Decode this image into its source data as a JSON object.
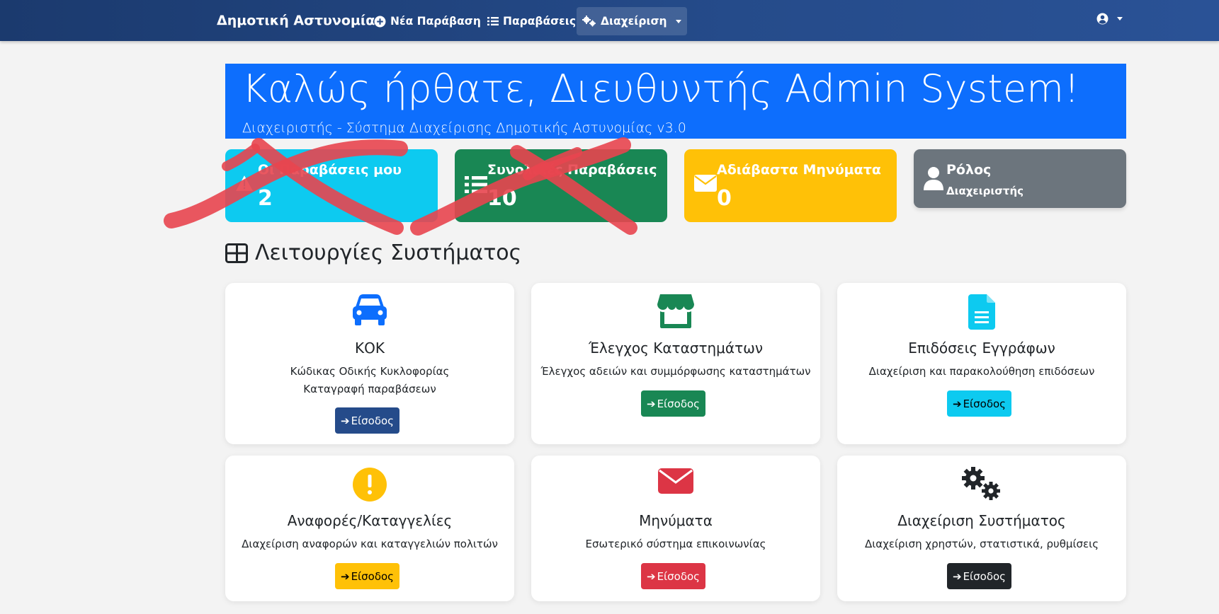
{
  "navbar": {
    "brand": "Δημοτική Αστυνομία",
    "items": [
      {
        "label": "Νέα Παράβαση",
        "icon": "plus-circle-icon"
      },
      {
        "label": "Παραβάσεις",
        "icon": "list-icon"
      },
      {
        "label": "Διαχείριση",
        "icon": "gears-icon",
        "has_dropdown": true,
        "active": true
      }
    ],
    "user_icon": "user-circle-icon"
  },
  "hero": {
    "title": "Καλώς ήρθατε, Διευθυντής Admin System!",
    "subtitle": "Διαχειριστής - Σύστημα Διαχείρισης Δημοτικής Αστυνομίας v3.0",
    "color": "#0d6efd"
  },
  "stats": [
    {
      "label": "Οι Παραβάσεις μου",
      "value": "2",
      "icon": "warning-icon",
      "color": "#0dcaf0",
      "crossed_out": true
    },
    {
      "label": "Συνολικές Παραβάσεις",
      "value": "10",
      "icon": "list-icon",
      "color": "#198754",
      "crossed_out": true
    },
    {
      "label": "Αδιάβαστα Μηνύματα",
      "value": "0",
      "icon": "envelope-icon",
      "color": "#ffc107"
    },
    {
      "label": "Ρόλος",
      "value": "Διαχειριστής",
      "icon": "user-icon",
      "color": "#6c757d"
    }
  ],
  "section": {
    "title": "Λειτουργίες Συστήματος",
    "icon": "grid-icon"
  },
  "modules": [
    {
      "title": "ΚΟΚ",
      "desc": [
        "Κώδικας Οδικής Κυκλοφορίας",
        "Καταγραφή παραβάσεων"
      ],
      "button": "Είσοδος",
      "icon": "car-icon",
      "icon_color": "#0d6efd",
      "btn_color": "#254b8a",
      "btn_text_color": "#ffffff"
    },
    {
      "title": "Έλεγχος Καταστημάτων",
      "desc": [
        "Έλεγχος αδειών και συμμόρφωσης καταστημάτων"
      ],
      "button": "Είσοδος",
      "icon": "store-icon",
      "icon_color": "#198754",
      "btn_color": "#198754",
      "btn_text_color": "#ffffff"
    },
    {
      "title": "Επιδόσεις Εγγράφων",
      "desc": [
        "Διαχείριση και παρακολούθηση επιδόσεων"
      ],
      "button": "Είσοδος",
      "icon": "document-icon",
      "icon_color": "#0dcaf0",
      "btn_color": "#0dcaf0",
      "btn_text_color": "#000000"
    },
    {
      "title": "Αναφορές/Καταγγελίες",
      "desc": [
        "Διαχείριση αναφορών και καταγγελιών πολιτών"
      ],
      "button": "Είσοδος",
      "icon": "exclamation-circle-icon",
      "icon_color": "#ffc107",
      "btn_color": "#ffc107",
      "btn_text_color": "#000000"
    },
    {
      "title": "Μηνύματα",
      "desc": [
        "Εσωτερικό σύστημα επικοινωνίας"
      ],
      "button": "Είσοδος",
      "icon": "envelope-icon",
      "icon_color": "#dc3545",
      "btn_color": "#dc3545",
      "btn_text_color": "#ffffff"
    },
    {
      "title": "Διαχείριση Συστήματος",
      "desc": [
        "Διαχείριση χρηστών, στατιστικά, ρυθμίσεις"
      ],
      "button": "Είσοδος",
      "icon": "gears-icon",
      "icon_color": "#212529",
      "btn_color": "#212529",
      "btn_text_color": "#ffffff"
    }
  ]
}
